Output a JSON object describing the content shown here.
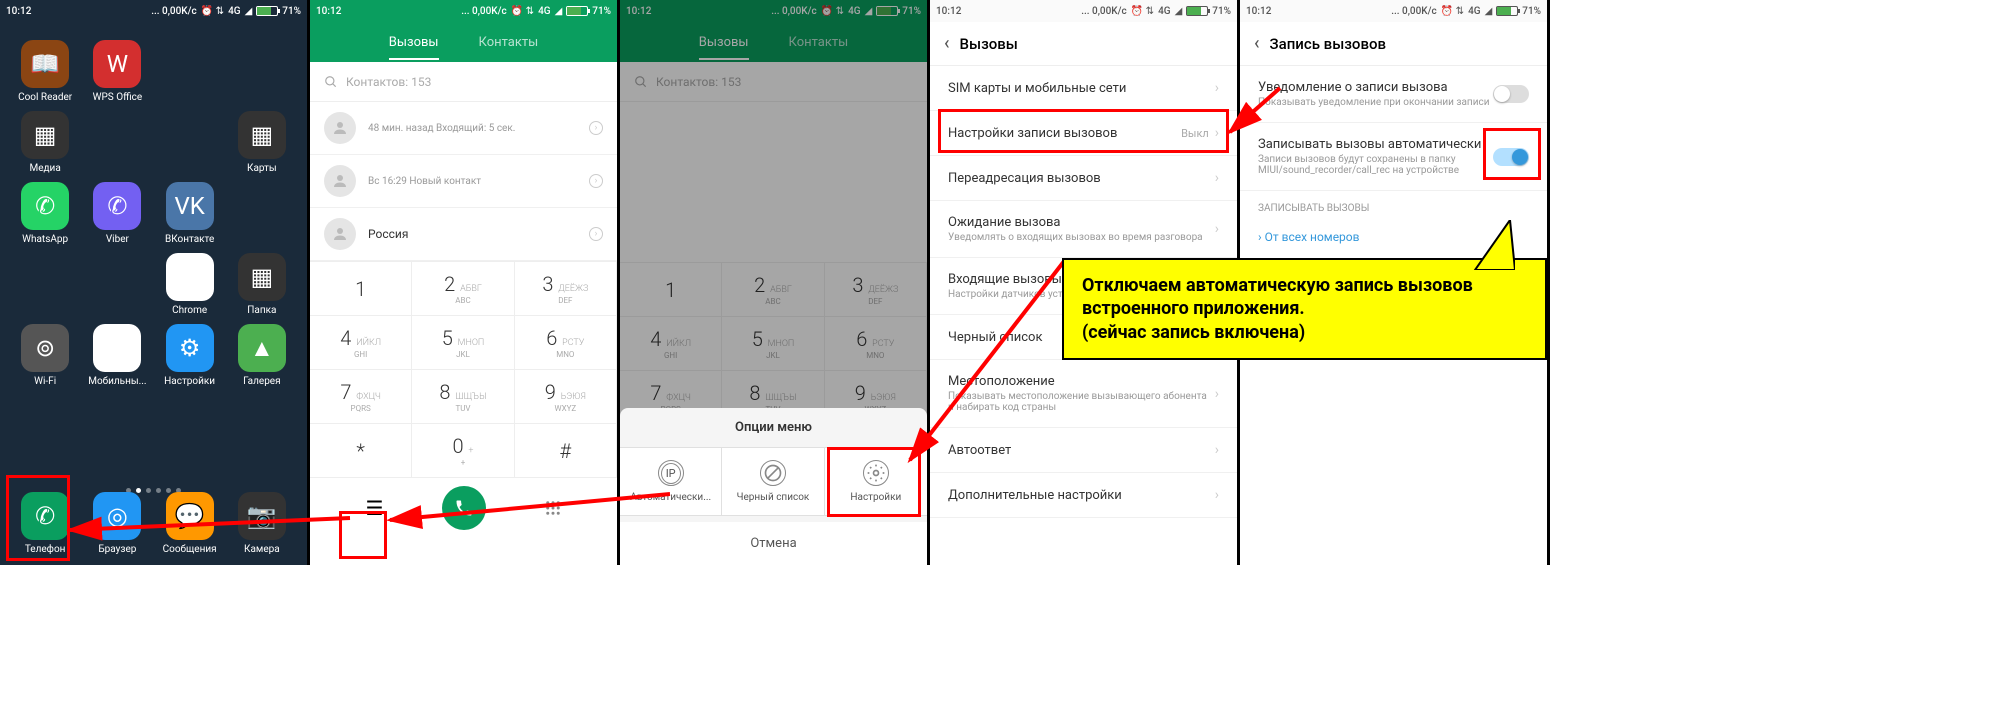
{
  "status": {
    "time": "10:12",
    "net": "... 0,00K/c",
    "signal": "4G",
    "battery": "71%"
  },
  "screen1": {
    "apps": [
      {
        "label": "Cool Reader",
        "color": "#8b4513",
        "icon": "📖"
      },
      {
        "label": "WPS Office",
        "color": "#d32f2f",
        "icon": "W"
      },
      {
        "label": "Медиа",
        "color": "#333",
        "icon": "▦"
      },
      {
        "label": "Карты",
        "color": "#333",
        "icon": "▦"
      },
      {
        "label": "WhatsApp",
        "color": "#25d366",
        "icon": "✆"
      },
      {
        "label": "Viber",
        "color": "#7360f2",
        "icon": "✆"
      },
      {
        "label": "ВКонтакте",
        "color": "#4a76a8",
        "icon": "VK"
      },
      {
        "label": "Chrome",
        "color": "#fff",
        "icon": "◉"
      },
      {
        "label": "Папка",
        "color": "#333",
        "icon": "▦"
      },
      {
        "label": "Wi-Fi",
        "color": "#555",
        "icon": "⊚"
      },
      {
        "label": "Мобильны...",
        "color": "#fff",
        "icon": "↕"
      },
      {
        "label": "Настройки",
        "color": "#2196f3",
        "icon": "⚙"
      },
      {
        "label": "Галерея",
        "color": "#4caf50",
        "icon": "▲"
      }
    ],
    "dock": [
      {
        "label": "Телефон",
        "color": "#0a9e5f",
        "icon": "✆"
      },
      {
        "label": "Браузер",
        "color": "#2196f3",
        "icon": "◎"
      },
      {
        "label": "Сообщения",
        "color": "#ff9800",
        "icon": "💬"
      },
      {
        "label": "Камера",
        "color": "#333",
        "icon": "📷"
      }
    ]
  },
  "screen2": {
    "tabs": {
      "calls": "Вызовы",
      "contacts": "Контакты"
    },
    "search_placeholder": "Контактов: 153",
    "items": [
      {
        "main": "",
        "sub": "48 мин. назад Входящий: 5 сек."
      },
      {
        "main": "",
        "sub": "Вс 16:29 Новый контакт"
      },
      {
        "main": "Россия",
        "sub": ""
      }
    ],
    "keys": [
      {
        "n": "1",
        "s": ""
      },
      {
        "n": "2",
        "s": "АБВГ",
        "s2": "ABC"
      },
      {
        "n": "3",
        "s": "ДЕЁЖЗ",
        "s2": "DEF"
      },
      {
        "n": "4",
        "s": "ИЙКЛ",
        "s2": "GHI"
      },
      {
        "n": "5",
        "s": "МНОП",
        "s2": "JKL"
      },
      {
        "n": "6",
        "s": "РСТУ",
        "s2": "MNO"
      },
      {
        "n": "7",
        "s": "ФХЦЧ",
        "s2": "PQRS"
      },
      {
        "n": "8",
        "s": "ШЩЪЫ",
        "s2": "TUV"
      },
      {
        "n": "9",
        "s": "ЬЭЮЯ",
        "s2": "WXYZ"
      },
      {
        "n": "*",
        "s": ""
      },
      {
        "n": "0",
        "s": "+"
      },
      {
        "n": "#",
        "s": ""
      }
    ]
  },
  "screen3": {
    "options_title": "Опции меню",
    "options": [
      {
        "label": "Автоматически..."
      },
      {
        "label": "Черный список"
      },
      {
        "label": "Настройки"
      }
    ],
    "cancel": "Отмена"
  },
  "screen4": {
    "title": "Вызовы",
    "rows": [
      {
        "title": "SIM карты и мобильные сети",
        "sub": ""
      },
      {
        "title": "Настройки записи вызовов",
        "sub": "",
        "right": "Выкл"
      },
      {
        "title": "Переадресация вызовов",
        "sub": ""
      },
      {
        "title": "Ожидание вызова",
        "sub": "Уведомлять о входящих вызовах во время разговора"
      },
      {
        "title": "Входящие вызовы",
        "sub": "Настройки датчиков устройства при входящем вызове"
      },
      {
        "title": "Черный список",
        "sub": ""
      },
      {
        "title": "Местоположение",
        "sub": "Показывать местоположение вызывающего абонента и набирать код страны"
      },
      {
        "title": "Автоответ",
        "sub": ""
      },
      {
        "title": "Дополнительные настройки",
        "sub": ""
      }
    ]
  },
  "screen5": {
    "title": "Запись вызовов",
    "rows": [
      {
        "title": "Уведомление о записи вызова",
        "sub": "Показывать уведомление при окончании записи",
        "toggle": false
      },
      {
        "title": "Записывать вызовы автоматически",
        "sub": "Записи вызовов будут сохранены в папку MIUI/sound_recorder/call_rec на устройстве",
        "toggle": true
      }
    ],
    "section": "ЗАПИСЫВАТЬ ВЫЗОВЫ",
    "link": "От всех номеров"
  },
  "callout": "Отключаем автоматическую запись вызовов встроенного приложения.\n(сейчас запись включена)"
}
